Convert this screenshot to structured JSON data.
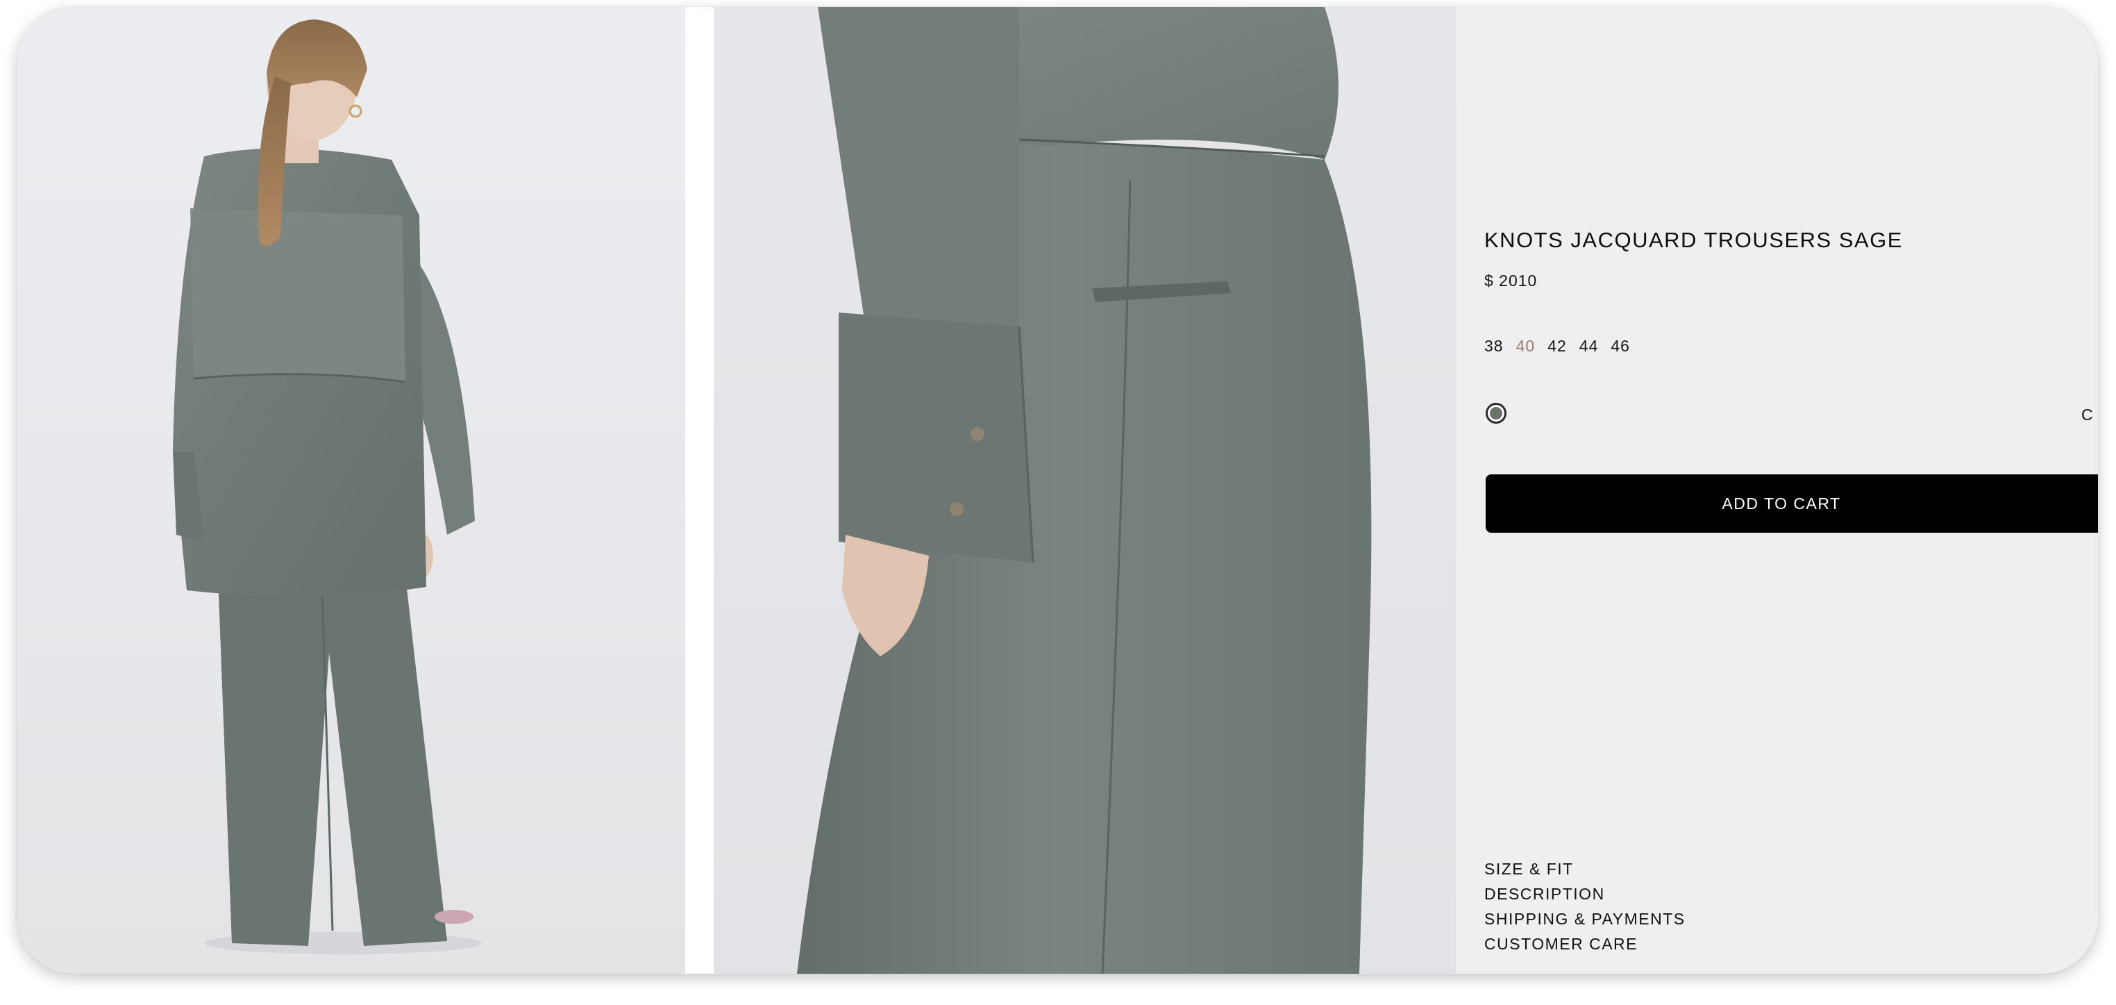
{
  "product": {
    "title": "KNOTS JACQUARD TROUSERS SAGE",
    "price": "$ 2010",
    "sizes": [
      "38",
      "40",
      "42",
      "44",
      "46"
    ],
    "selected_size": "40",
    "color_label": "C",
    "swatch_color": "#6b7268",
    "add_to_cart_label": "ADD TO CART"
  },
  "info_links": [
    "SIZE & FIT",
    "DESCRIPTION",
    "SHIPPING & PAYMENTS",
    "CUSTOMER CARE"
  ],
  "images": [
    {
      "name": "product-image-full-back-view"
    },
    {
      "name": "product-image-trousers-detail"
    }
  ],
  "colors": {
    "garment": "#707a76",
    "selected_size": "#9c7b6e",
    "panel_bg": "#efeff0",
    "button_bg": "#000000"
  }
}
